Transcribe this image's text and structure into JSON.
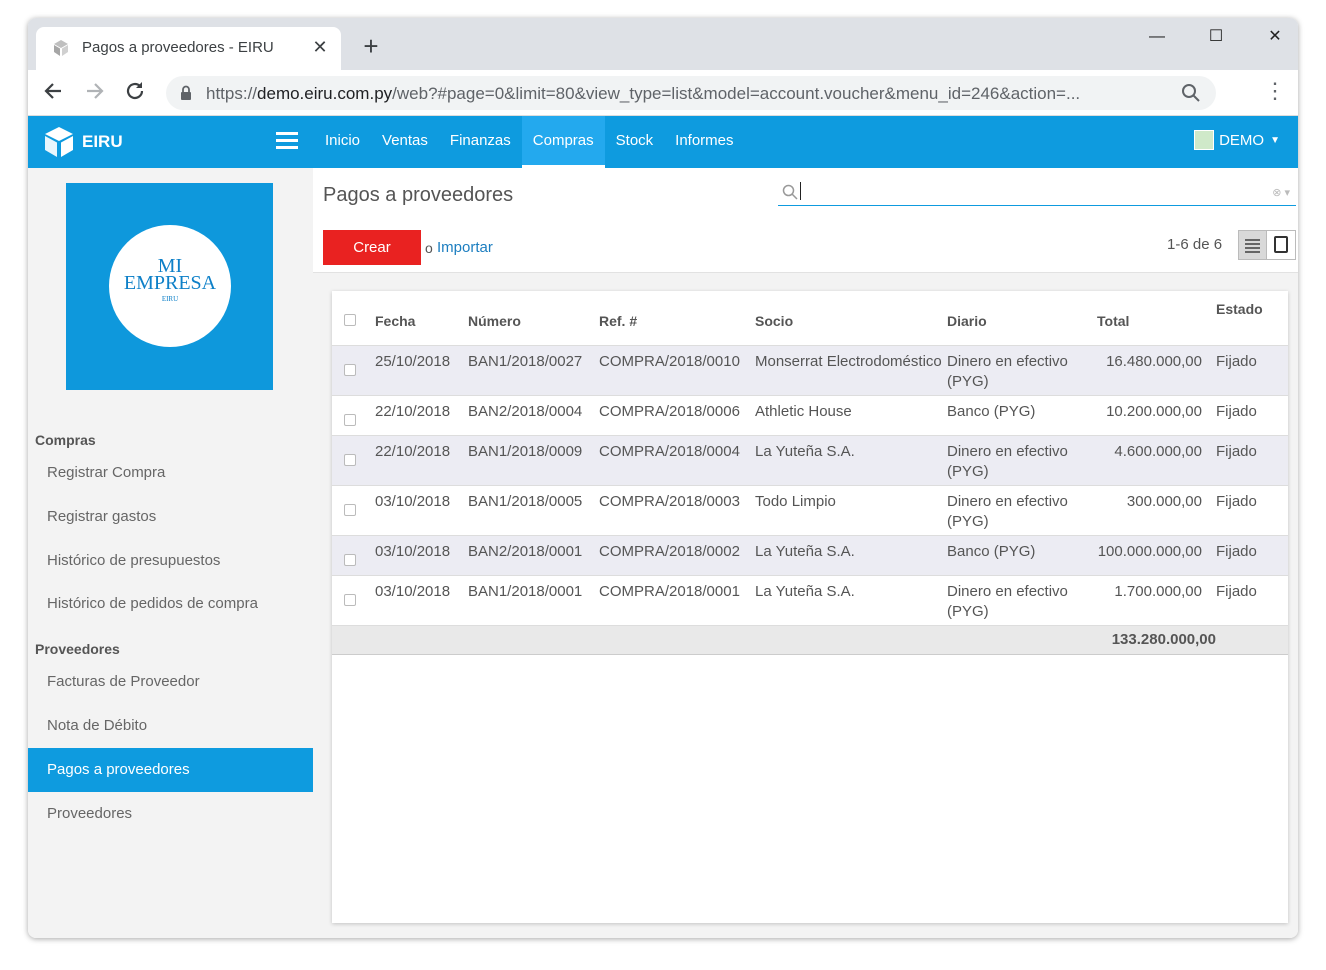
{
  "browser": {
    "tab_title": "Pagos a proveedores - EIRU",
    "new_tab": "+",
    "url_prefix": "https://",
    "url_host": "demo.eiru.com.py",
    "url_path": "/web?#page=0&limit=80&view_type=list&model=account.voucher&menu_id=246&action=...",
    "minimize": "—",
    "maximize": "☐",
    "close": "✕"
  },
  "appbar": {
    "brand": "EIRU",
    "menu": [
      {
        "label": "Inicio"
      },
      {
        "label": "Ventas"
      },
      {
        "label": "Finanzas"
      },
      {
        "label": "Compras",
        "active": true
      },
      {
        "label": "Stock"
      },
      {
        "label": "Informes"
      }
    ],
    "user": "DEMO"
  },
  "sidebar": {
    "logo": {
      "line1": "MI",
      "line2": "EMPRESA",
      "line3": "EIRU"
    },
    "sections": [
      {
        "title": "Compras",
        "items": [
          "Registrar Compra",
          "Registrar gastos",
          "Histórico de presupuestos",
          "Histórico de pedidos de compra"
        ]
      },
      {
        "title": "Proveedores",
        "items": [
          "Facturas de Proveedor",
          "Nota de Débito",
          "Pagos a proveedores",
          "Proveedores"
        ]
      }
    ],
    "active_item": "Pagos a proveedores"
  },
  "control_panel": {
    "title": "Pagos a proveedores",
    "search_placeholder": "",
    "create_label": "Crear",
    "or_label": "o",
    "import_label": "Importar",
    "pager": "1-6 de 6"
  },
  "table": {
    "columns": [
      "Fecha",
      "Número",
      "Ref. #",
      "Socio",
      "Diario",
      "Total",
      "Estado"
    ],
    "rows": [
      {
        "fecha": "25/10/2018",
        "numero": "BAN1/2018/0027",
        "ref": "COMPRA/2018/0010",
        "socio": "Monserrat Electrodoméstico",
        "diario": "Dinero en efectivo (PYG)",
        "total": "16.480.000,00",
        "estado": "Fijado"
      },
      {
        "fecha": "22/10/2018",
        "numero": "BAN2/2018/0004",
        "ref": "COMPRA/2018/0006",
        "socio": "Athletic House",
        "diario": "Banco (PYG)",
        "total": "10.200.000,00",
        "estado": "Fijado"
      },
      {
        "fecha": "22/10/2018",
        "numero": "BAN1/2018/0009",
        "ref": "COMPRA/2018/0004",
        "socio": "La Yuteña S.A.",
        "diario": "Dinero en efectivo (PYG)",
        "total": "4.600.000,00",
        "estado": "Fijado"
      },
      {
        "fecha": "03/10/2018",
        "numero": "BAN1/2018/0005",
        "ref": "COMPRA/2018/0003",
        "socio": "Todo Limpio",
        "diario": "Dinero en efectivo (PYG)",
        "total": "300.000,00",
        "estado": "Fijado"
      },
      {
        "fecha": "03/10/2018",
        "numero": "BAN2/2018/0001",
        "ref": "COMPRA/2018/0002",
        "socio": "La Yuteña S.A.",
        "diario": "Banco (PYG)",
        "total": "100.000.000,00",
        "estado": "Fijado"
      },
      {
        "fecha": "03/10/2018",
        "numero": "BAN1/2018/0001",
        "ref": "COMPRA/2018/0001",
        "socio": "La Yuteña S.A.",
        "diario": "Dinero en efectivo (PYG)",
        "total": "1.700.000,00",
        "estado": "Fijado"
      }
    ],
    "grand_total": "133.280.000,00"
  },
  "colors": {
    "brand": "#0e9bdf",
    "create_button": "#e92221",
    "link": "#1c7ec0"
  }
}
